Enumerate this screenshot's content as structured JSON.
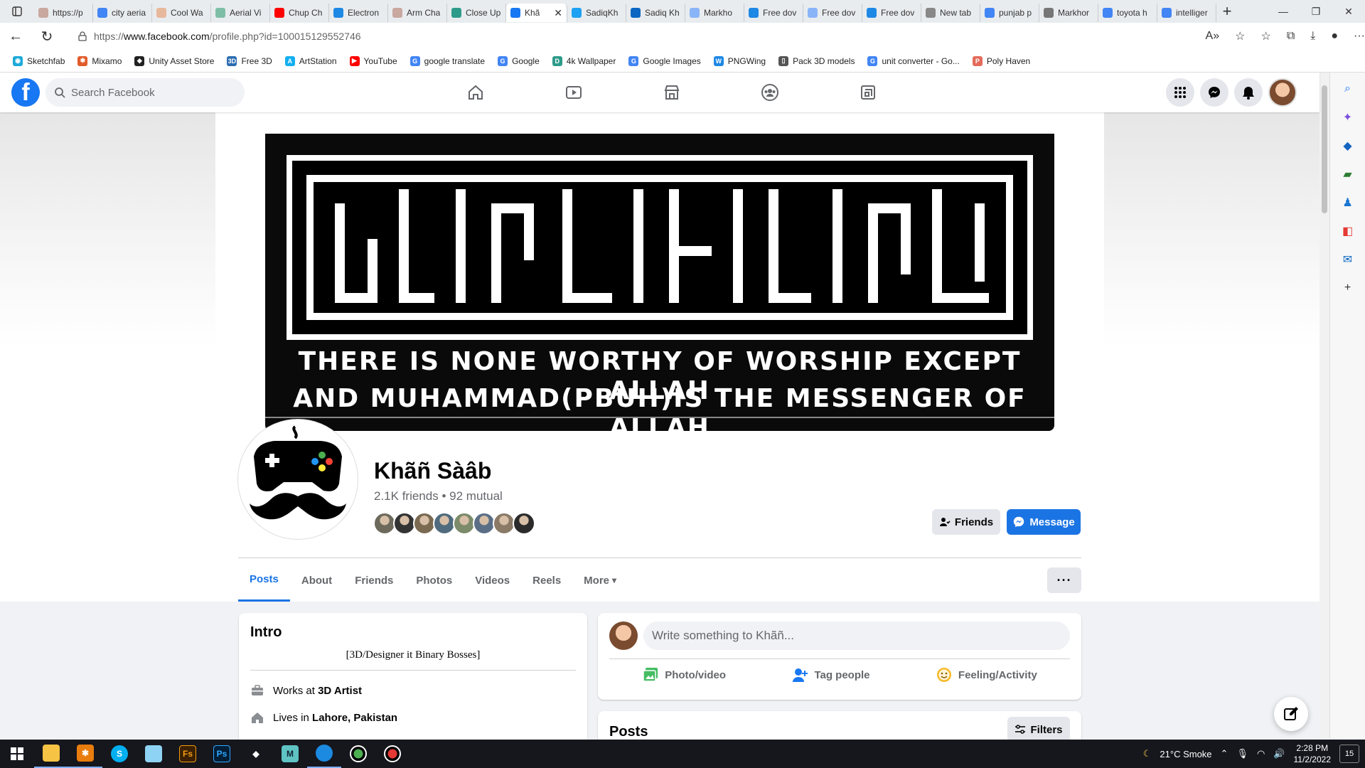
{
  "browser": {
    "tabs": [
      {
        "label": "https://p",
        "color": "#c9a8a0"
      },
      {
        "label": "city aeria",
        "color": "#4285f4"
      },
      {
        "label": "Cool Wa",
        "color": "#e8b89c"
      },
      {
        "label": "Aerial Vi",
        "color": "#7dbfa6"
      },
      {
        "label": "Chup Ch",
        "color": "#ff0000"
      },
      {
        "label": "Electron",
        "color": "#1e88e5"
      },
      {
        "label": "Arm Cha",
        "color": "#c9a8a0"
      },
      {
        "label": "Close Up",
        "color": "#2e9b8a"
      },
      {
        "label": "Khã",
        "color": "#1877f2",
        "active": true
      },
      {
        "label": "SadiqKh",
        "color": "#1da1f2"
      },
      {
        "label": "Sadiq Kh",
        "color": "#0a66c2"
      },
      {
        "label": "Markho",
        "color": "#8ab4f8"
      },
      {
        "label": "Free dov",
        "color": "#1e88e5"
      },
      {
        "label": "Free dov",
        "color": "#8ab4f8"
      },
      {
        "label": "Free dov",
        "color": "#1e88e5"
      },
      {
        "label": "New tab",
        "color": "#888888"
      },
      {
        "label": "punjab p",
        "color": "#4285f4"
      },
      {
        "label": "Markhor",
        "color": "#777777"
      },
      {
        "label": "toyota h",
        "color": "#4285f4"
      },
      {
        "label": "intelliger",
        "color": "#4285f4"
      }
    ],
    "url_prefix": "https://",
    "url_host": "www.facebook.com",
    "url_path": "/profile.php?id=100015129552746",
    "bookmarks": [
      {
        "label": "Sketchfab",
        "color": "#1caad9",
        "glyph": "◉"
      },
      {
        "label": "Mixamo",
        "color": "#e25b2a",
        "glyph": "✱"
      },
      {
        "label": "Unity Asset Store",
        "color": "#222222",
        "glyph": "◆"
      },
      {
        "label": "Free 3D",
        "color": "#2b6cb0",
        "glyph": "3D"
      },
      {
        "label": "ArtStation",
        "color": "#13aff0",
        "glyph": "A"
      },
      {
        "label": "YouTube",
        "color": "#ff0000",
        "glyph": "▶"
      },
      {
        "label": "google translate",
        "color": "#4285f4",
        "glyph": "G"
      },
      {
        "label": "Google",
        "color": "#4285f4",
        "glyph": "G"
      },
      {
        "label": "4k Wallpaper",
        "color": "#2e9b8a",
        "glyph": "D"
      },
      {
        "label": "Google Images",
        "color": "#4285f4",
        "glyph": "G"
      },
      {
        "label": "PNGWing",
        "color": "#1e88e5",
        "glyph": "W"
      },
      {
        "label": "Pack 3D models",
        "color": "#555555",
        "glyph": "▯"
      },
      {
        "label": "unit converter - Go...",
        "color": "#4285f4",
        "glyph": "G"
      },
      {
        "label": "Poly Haven",
        "color": "#e46b5b",
        "glyph": "P"
      }
    ]
  },
  "fb": {
    "search_placeholder": "Search Facebook",
    "profile": {
      "name": "Khãñ Sàâb",
      "friends_count": "2.1K friends",
      "separator": "•",
      "mutual": "92 mutual",
      "mutual_avatar_colors": [
        "#6d6a5c",
        "#333333",
        "#7a6a52",
        "#4f6b7d",
        "#7c8b6a",
        "#5a6e86",
        "#8a7a66",
        "#2b2b2b"
      ],
      "friends_button": "Friends",
      "message_button": "Message"
    },
    "cover": {
      "line1": "THERE IS NONE WORTHY OF WORSHIP EXCEPT ALLAH",
      "line2": "AND MUHAMMAD(PBUH)IS THE MESSENGER OF ALLAH"
    },
    "tabs": [
      "Posts",
      "About",
      "Friends",
      "Photos",
      "Videos",
      "Reels",
      "More"
    ],
    "intro": {
      "title": "Intro",
      "bio": "[3D/Designer it Binary Bosses]",
      "work_prefix": "Works at",
      "work_place": "3D Artist",
      "lives_prefix": "Lives in",
      "lives_place": "Lahore, Pakistan"
    },
    "composer": {
      "placeholder": "Write something to Khãñ...",
      "photo_video": "Photo/video",
      "tag_people": "Tag people",
      "feeling": "Feeling/Activity"
    },
    "posts": {
      "title": "Posts",
      "filters": "Filters"
    }
  },
  "taskbar": {
    "weather": "21°C  Smoke",
    "time": "2:28 PM",
    "date": "11/2/2022",
    "notifications": "15"
  }
}
